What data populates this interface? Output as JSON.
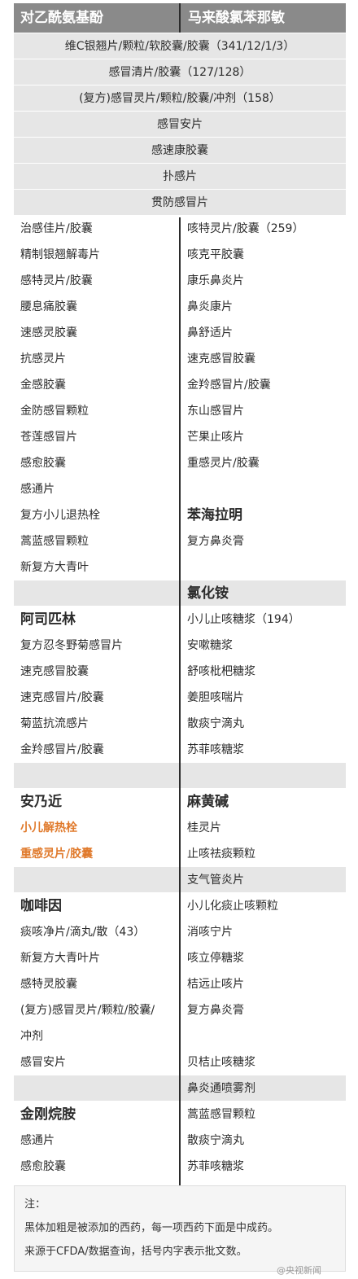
{
  "header": {
    "left": "对乙酰氨基酚",
    "right": "马来酸氯苯那敏"
  },
  "full_rows": [
    "维C银翘片/颗粒/软胶囊/胶囊（341/12/1/3）",
    "感冒清片/胶囊（127/128）",
    "(复方)感冒灵片/颗粒/胶囊/冲剂（158）",
    "感冒安片",
    "感速康胶囊",
    "扑感片",
    "贯防感冒片"
  ],
  "rows": [
    {
      "l": "治感佳片/胶囊",
      "r": "咳特灵片/胶囊（259）",
      "shade": false
    },
    {
      "l": "精制银翘解毒片",
      "r": "咳克平胶囊",
      "shade": false
    },
    {
      "l": "感特灵片/胶囊",
      "r": "康乐鼻炎片",
      "shade": false
    },
    {
      "l": "腰息痛胶囊",
      "r": "鼻炎康片",
      "shade": false
    },
    {
      "l": "速感灵胶囊",
      "r": "鼻舒适片",
      "shade": false
    },
    {
      "l": "抗感灵片",
      "r": "速克感冒胶囊",
      "shade": false
    },
    {
      "l": "金感胶囊",
      "r": "金羚感冒片/胶囊",
      "shade": false
    },
    {
      "l": "金防感冒颗粒",
      "r": "东山感冒片",
      "shade": false
    },
    {
      "l": "苍莲感冒片",
      "r": "芒果止咳片",
      "shade": false
    },
    {
      "l": "感愈胶囊",
      "r": "重感灵片/胶囊",
      "shade": false
    },
    {
      "l": "感通片",
      "r": "",
      "shade": false
    },
    {
      "l": "复方小儿退热栓",
      "r": "苯海拉明",
      "rsec": true,
      "shade": false
    },
    {
      "l": "蒿蓝感冒颗粒",
      "r": "复方鼻炎膏",
      "shade": false
    },
    {
      "l": "新复方大青叶",
      "r": "",
      "shade": false
    },
    {
      "l": "",
      "r": "氯化铵",
      "rsec": true,
      "shade": true
    },
    {
      "l": "阿司匹林",
      "lsec": true,
      "r": "小儿止咳糖浆（194）",
      "shade": false
    },
    {
      "l": "复方忍冬野菊感冒片",
      "r": "安嗽糖浆",
      "shade": false
    },
    {
      "l": "速克感冒胶囊",
      "r": "舒咳枇杷糖浆",
      "shade": false
    },
    {
      "l": "速克感冒片/胶囊",
      "r": "姜胆咳喘片",
      "shade": false
    },
    {
      "l": "菊蓝抗流感片",
      "r": "散痰宁滴丸",
      "shade": false
    },
    {
      "l": "金羚感冒片/胶囊",
      "r": "苏菲咳糖浆",
      "shade": false
    },
    {
      "l": "",
      "r": "",
      "shade": true
    },
    {
      "l": "安乃近",
      "lsec": true,
      "r": "麻黄碱",
      "rsec": true,
      "shade": false
    },
    {
      "l": "小儿解热栓",
      "lorange": true,
      "r": "桂灵片",
      "shade": false
    },
    {
      "l": "重感灵片/胶囊",
      "lorange": true,
      "r": "止咳祛痰颗粒",
      "shade": false
    },
    {
      "l": "",
      "r": "支气管炎片",
      "shade": true
    },
    {
      "l": "咖啡因",
      "lsec": true,
      "r": "小儿化痰止咳颗粒",
      "shade": false
    },
    {
      "l": "痰咳净片/滴丸/散（43）",
      "r": "消咳宁片",
      "shade": false
    },
    {
      "l": "新复方大青叶片",
      "r": "咳立停糖浆",
      "shade": false
    },
    {
      "l": "感特灵胶囊",
      "r": "桔远止咳片",
      "shade": false
    },
    {
      "l": "(复方)感冒灵片/颗粒/胶囊/",
      "r": "复方鼻炎膏",
      "shade": false
    },
    {
      "l": "冲剂",
      "r": "",
      "shade": false
    },
    {
      "l": "感冒安片",
      "r": "贝桔止咳糖浆",
      "shade": false
    },
    {
      "l": "",
      "r": "鼻炎通喷雾剂",
      "shade": true
    },
    {
      "l": "金刚烷胺",
      "lsec": true,
      "r": "蒿蓝感冒颗粒",
      "shade": false
    },
    {
      "l": "感通片",
      "r": "散痰宁滴丸",
      "shade": false
    },
    {
      "l": "感愈胶囊",
      "r": "苏菲咳糖浆",
      "shade": false
    }
  ],
  "note": {
    "title": "注：",
    "line1": "黑体加粗是被添加的西药，每一项西药下面是中成药。",
    "line2": "来源于CFDA/数据查询，括号内字表示批文数。"
  },
  "watermark": "@央视新闻",
  "colors": {
    "header_bg": "#8a8a8a",
    "shade": "#e6e6e6",
    "highlight": "#e07a2c"
  }
}
